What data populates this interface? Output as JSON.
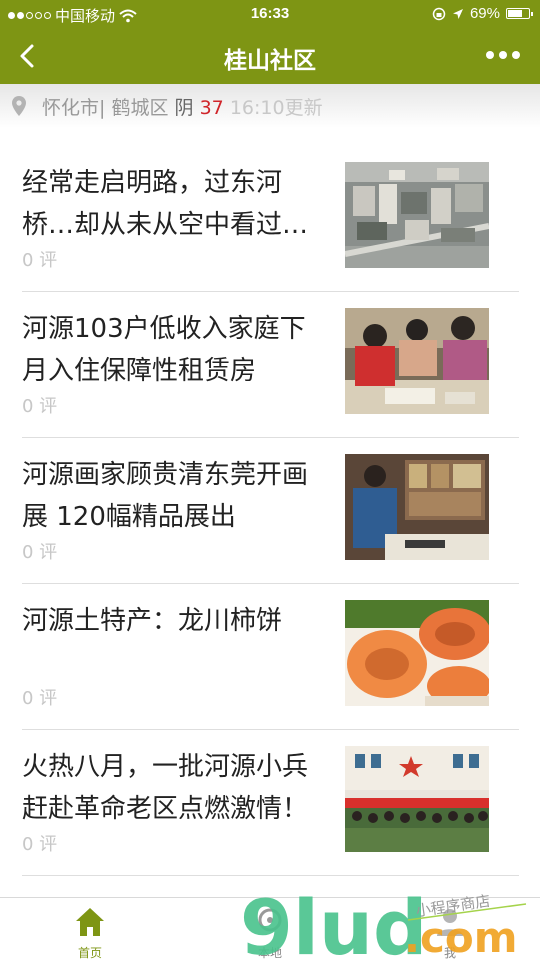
{
  "status_bar": {
    "carrier": "中国移动",
    "time": "16:33",
    "battery": "69%",
    "battery_level": 0.69
  },
  "nav": {
    "title": "桂山社区"
  },
  "location": {
    "city": "怀化市",
    "district": "鹤城区",
    "weather": "阴",
    "temperature": "37",
    "updated": "16:10更新"
  },
  "articles": [
    {
      "title": "经常走启明路，过东河桥…却从未从空中看过…",
      "comments": "0 评"
    },
    {
      "title": "河源103户低收入家庭下月入住保障性租赁房",
      "comments": "0 评"
    },
    {
      "title": "河源画家顾贵清东莞开画展 120幅精品展出",
      "comments": "0 评"
    },
    {
      "title": "河源土特产：龙川柿饼",
      "comments": "0 评"
    },
    {
      "title": "火热八月，一批河源小兵赶赴革命老区点燃激情！",
      "comments": "0 评"
    }
  ],
  "tabs": [
    {
      "label": "首页",
      "icon": "home-icon",
      "active": true
    },
    {
      "label": "本地",
      "icon": "location-icon",
      "active": false
    },
    {
      "label": "我",
      "icon": "user-icon",
      "active": false
    }
  ],
  "watermark": {
    "text": "9lud",
    "suffix": ".com",
    "tagline": "小程序商店"
  },
  "colors": {
    "primary": "#7e9514",
    "temperature": "#d0252a",
    "muted": "#c7c7c7"
  }
}
